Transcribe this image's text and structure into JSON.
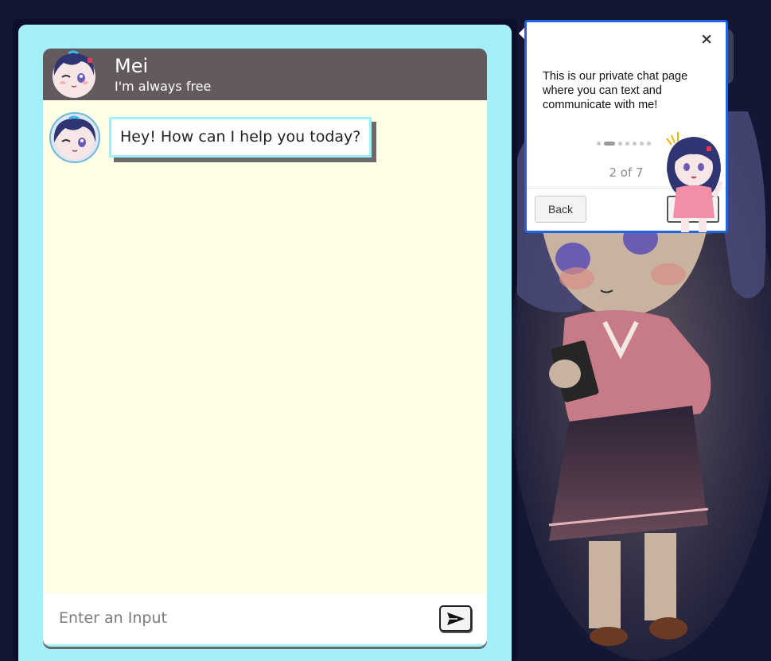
{
  "chat": {
    "name": "Mei",
    "status": "I'm always free",
    "messages": [
      {
        "sender": "Mei",
        "text": "Hey! How can I help you today?"
      }
    ],
    "input_placeholder": "Enter an Input",
    "send_icon": "send-arrow-icon"
  },
  "tour": {
    "close_label": "×",
    "text": "This is our private chat page where you can text and communicate with me!",
    "progress_label": "2 of 7",
    "current_step": 2,
    "total_steps": 7,
    "back_label": "Back",
    "next_label": "Next"
  },
  "colors": {
    "background": "#141733",
    "panel": "#a3f0fb",
    "header": "#625a5f",
    "chat_body": "#ffffe6",
    "popover_border": "#1f63e6"
  }
}
